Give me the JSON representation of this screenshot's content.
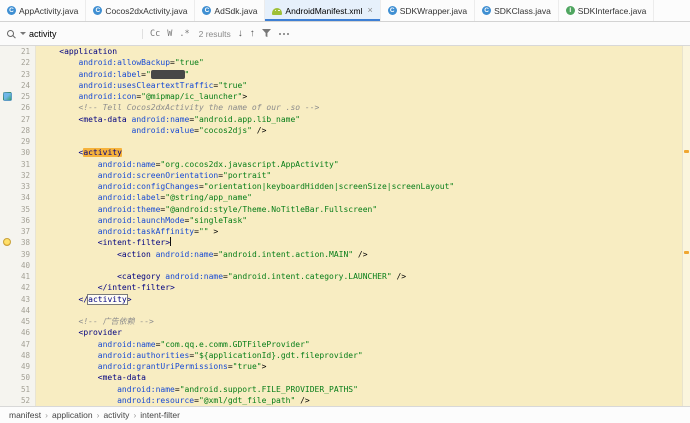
{
  "colors": {
    "accent": "#3d7fd4",
    "editor_bg": "#f8edc2",
    "gutter_bg": "#f5f4ef",
    "match_bg": "#f6b23b",
    "tag": "#000080",
    "attr": "#174ad4",
    "value": "#067d17",
    "comment": "#8c8c8c"
  },
  "tab_bar": {
    "close_glyph": "×",
    "tabs": [
      {
        "label": "AppActivity.java",
        "icon": "java-class",
        "active": false
      },
      {
        "label": "Cocos2dxActivity.java",
        "icon": "java-class",
        "active": false
      },
      {
        "label": "AdSdk.java",
        "icon": "java-class",
        "active": false
      },
      {
        "label": "AndroidManifest.xml",
        "icon": "android",
        "active": true
      },
      {
        "label": "SDKWrapper.java",
        "icon": "java-class",
        "active": false
      },
      {
        "label": "SDKClass.java",
        "icon": "java-class",
        "active": false
      },
      {
        "label": "SDKInterface.java",
        "icon": "java-interface",
        "active": false
      }
    ]
  },
  "find_bar": {
    "query": "activity",
    "match_case_label": "Cc",
    "words_label": "W",
    "regex_label": ".*",
    "results_label": "2 results",
    "next_icon": "↓",
    "prev_icon": "↑"
  },
  "breadcrumbs": {
    "separator": "›",
    "items": [
      "manifest",
      "application",
      "activity",
      "intent-filter"
    ]
  },
  "scrollbar": {
    "marks": [
      {
        "top_pct": 29,
        "color": "#f0a732"
      },
      {
        "top_pct": 57,
        "color": "#f0a732"
      }
    ]
  },
  "editor": {
    "lines": [
      {
        "n": 21,
        "tk": [
          [
            "    ",
            "pl"
          ],
          [
            "<application",
            "tag"
          ]
        ]
      },
      {
        "n": 22,
        "tk": [
          [
            "        ",
            "pl"
          ],
          [
            "android:allowBackup",
            "attr"
          ],
          [
            "=",
            "pl"
          ],
          [
            "\"true\"",
            "val"
          ]
        ]
      },
      {
        "n": 23,
        "tk": [
          [
            "        ",
            "pl"
          ],
          [
            "android:label",
            "attr"
          ],
          [
            "=",
            "pl"
          ],
          [
            "\"",
            "val"
          ],
          [
            "       ",
            "rd"
          ],
          [
            "\"",
            "val"
          ]
        ]
      },
      {
        "n": 24,
        "tk": [
          [
            "        ",
            "pl"
          ],
          [
            "android:usesCleartextTraffic",
            "attr"
          ],
          [
            "=",
            "pl"
          ],
          [
            "\"true\"",
            "val"
          ]
        ]
      },
      {
        "n": 25,
        "icon": "launcher-preview",
        "tk": [
          [
            "        ",
            "pl"
          ],
          [
            "android:icon",
            "attr"
          ],
          [
            "=",
            "pl"
          ],
          [
            "\"@mipmap/ic_launcher\"",
            "val"
          ],
          [
            ">",
            "pl"
          ]
        ]
      },
      {
        "n": 26,
        "tk": [
          [
            "        ",
            "pl"
          ],
          [
            "<!-- Tell Cocos2dxActivity the name of our .so -->",
            "cm"
          ]
        ]
      },
      {
        "n": 27,
        "tk": [
          [
            "        ",
            "pl"
          ],
          [
            "<meta-data",
            "tag"
          ],
          [
            " ",
            "pl"
          ],
          [
            "android:name",
            "attr"
          ],
          [
            "=",
            "pl"
          ],
          [
            "\"android.app.lib_name\"",
            "val"
          ]
        ]
      },
      {
        "n": 28,
        "tk": [
          [
            "                   ",
            "pl"
          ],
          [
            "android:value",
            "attr"
          ],
          [
            "=",
            "pl"
          ],
          [
            "\"cocos2djs\"",
            "val"
          ],
          [
            " />",
            "pl"
          ]
        ]
      },
      {
        "n": 29,
        "tk": []
      },
      {
        "n": 30,
        "tk": [
          [
            "        ",
            "pl"
          ],
          [
            "<",
            "tag"
          ],
          [
            "activity",
            "tag m"
          ]
        ]
      },
      {
        "n": 31,
        "tk": [
          [
            "            ",
            "pl"
          ],
          [
            "android:name",
            "attr"
          ],
          [
            "=",
            "pl"
          ],
          [
            "\"org.cocos2dx.javascript.AppActivity\"",
            "val"
          ]
        ]
      },
      {
        "n": 32,
        "tk": [
          [
            "            ",
            "pl"
          ],
          [
            "android:screenOrientation",
            "attr"
          ],
          [
            "=",
            "pl"
          ],
          [
            "\"portrait\"",
            "val"
          ]
        ]
      },
      {
        "n": 33,
        "tk": [
          [
            "            ",
            "pl"
          ],
          [
            "android:configChanges",
            "attr"
          ],
          [
            "=",
            "pl"
          ],
          [
            "\"orientation|keyboardHidden|screenSize|screenLayout\"",
            "val"
          ]
        ]
      },
      {
        "n": 34,
        "tk": [
          [
            "            ",
            "pl"
          ],
          [
            "android:label",
            "attr"
          ],
          [
            "=",
            "pl"
          ],
          [
            "\"@string/app_name\"",
            "val"
          ]
        ]
      },
      {
        "n": 35,
        "tk": [
          [
            "            ",
            "pl"
          ],
          [
            "android:theme",
            "attr"
          ],
          [
            "=",
            "pl"
          ],
          [
            "\"@android:style/Theme.NoTitleBar.Fullscreen\"",
            "val"
          ]
        ]
      },
      {
        "n": 36,
        "tk": [
          [
            "            ",
            "pl"
          ],
          [
            "android:launchMode",
            "attr"
          ],
          [
            "=",
            "pl"
          ],
          [
            "\"singleTask\"",
            "val"
          ]
        ]
      },
      {
        "n": 37,
        "tk": [
          [
            "            ",
            "pl"
          ],
          [
            "android:taskAffinity",
            "attr"
          ],
          [
            "=",
            "pl"
          ],
          [
            "\"\"",
            "val"
          ],
          [
            " >",
            "pl"
          ]
        ]
      },
      {
        "n": 38,
        "icon": "bulb",
        "tk": [
          [
            "            ",
            "pl"
          ],
          [
            "<intent-filter>",
            "tag"
          ],
          [
            "",
            "caret"
          ]
        ]
      },
      {
        "n": 39,
        "tk": [
          [
            "                ",
            "pl"
          ],
          [
            "<action",
            "tag"
          ],
          [
            " ",
            "pl"
          ],
          [
            "android:name",
            "attr"
          ],
          [
            "=",
            "pl"
          ],
          [
            "\"android.intent.action.MAIN\"",
            "val"
          ],
          [
            " />",
            "pl"
          ]
        ]
      },
      {
        "n": 40,
        "tk": []
      },
      {
        "n": 41,
        "tk": [
          [
            "                ",
            "pl"
          ],
          [
            "<category",
            "tag"
          ],
          [
            " ",
            "pl"
          ],
          [
            "android:name",
            "attr"
          ],
          [
            "=",
            "pl"
          ],
          [
            "\"android.intent.category.LAUNCHER\"",
            "val"
          ],
          [
            " />",
            "pl"
          ]
        ]
      },
      {
        "n": 42,
        "tk": [
          [
            "            ",
            "pl"
          ],
          [
            "</intent-filter>",
            "tag"
          ]
        ]
      },
      {
        "n": 43,
        "tk": [
          [
            "        ",
            "pl"
          ],
          [
            "</",
            "tag"
          ],
          [
            "activity",
            "tag cur"
          ],
          [
            ">",
            "tag"
          ]
        ]
      },
      {
        "n": 44,
        "tk": []
      },
      {
        "n": 45,
        "tk": [
          [
            "        ",
            "pl"
          ],
          [
            "<!-- 广告依赖 -->",
            "cm"
          ]
        ]
      },
      {
        "n": 46,
        "tk": [
          [
            "        ",
            "pl"
          ],
          [
            "<provider",
            "tag"
          ]
        ]
      },
      {
        "n": 47,
        "tk": [
          [
            "            ",
            "pl"
          ],
          [
            "android:name",
            "attr"
          ],
          [
            "=",
            "pl"
          ],
          [
            "\"com.qq.e.comm.GDTFileProvider\"",
            "val"
          ]
        ]
      },
      {
        "n": 48,
        "tk": [
          [
            "            ",
            "pl"
          ],
          [
            "android:authorities",
            "attr"
          ],
          [
            "=",
            "pl"
          ],
          [
            "\"${applicationId}.gdt.fileprovider\"",
            "val"
          ]
        ]
      },
      {
        "n": 49,
        "tk": [
          [
            "            ",
            "pl"
          ],
          [
            "android:grantUriPermissions",
            "attr"
          ],
          [
            "=",
            "pl"
          ],
          [
            "\"true\"",
            "val"
          ],
          [
            ">",
            "pl"
          ]
        ]
      },
      {
        "n": 50,
        "tk": [
          [
            "            ",
            "pl"
          ],
          [
            "<meta-data",
            "tag"
          ]
        ]
      },
      {
        "n": 51,
        "tk": [
          [
            "                ",
            "pl"
          ],
          [
            "android:name",
            "attr"
          ],
          [
            "=",
            "pl"
          ],
          [
            "\"android.support.FILE_PROVIDER_PATHS\"",
            "val"
          ]
        ]
      },
      {
        "n": 52,
        "tk": [
          [
            "                ",
            "pl"
          ],
          [
            "android:resource",
            "attr"
          ],
          [
            "=",
            "pl"
          ],
          [
            "\"@xml/gdt_file_path\"",
            "val"
          ],
          [
            " />",
            "pl"
          ]
        ]
      }
    ]
  }
}
